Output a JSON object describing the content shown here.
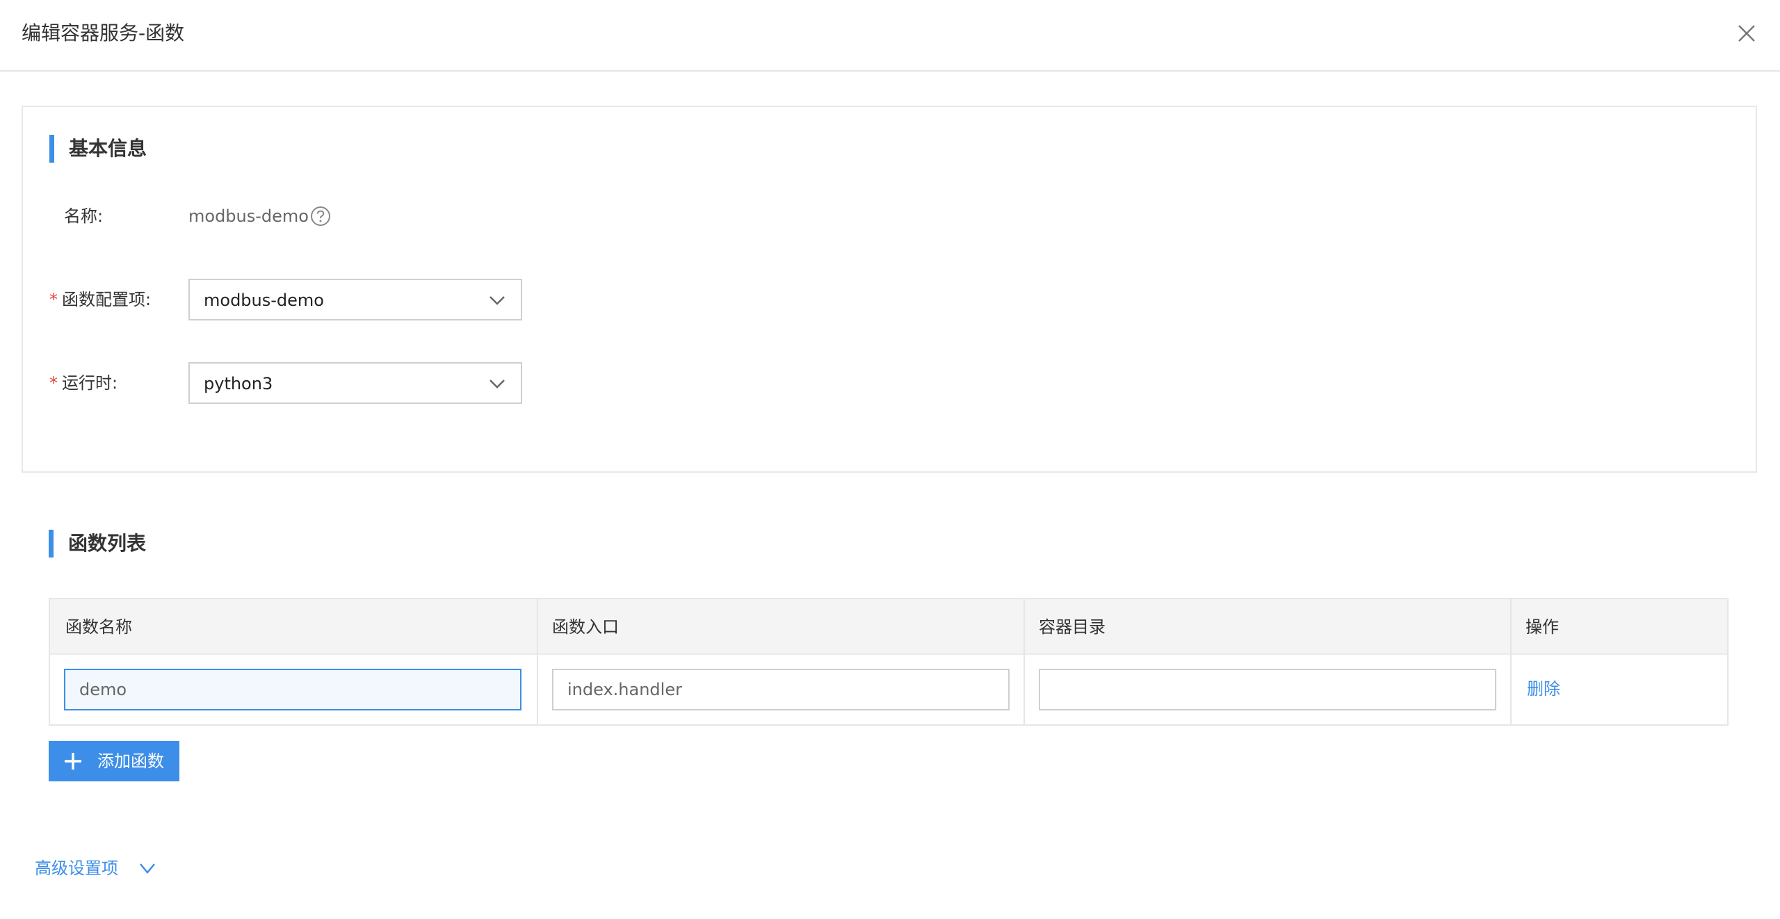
{
  "dialog": {
    "title": "编辑容器服务-函数"
  },
  "basic_info": {
    "section_title": "基本信息",
    "name_label": "名称:",
    "name_value": "modbus-demo",
    "function_config_label": "函数配置项:",
    "function_config_value": "modbus-demo",
    "runtime_label": "运行时:",
    "runtime_value": "python3",
    "required_marker": "*"
  },
  "function_list": {
    "section_title": "函数列表",
    "columns": [
      "函数名称",
      "函数入口",
      "容器目录",
      "操作"
    ],
    "rows": [
      {
        "name": "demo",
        "entry": "index.handler",
        "directory": "",
        "action": "删除"
      }
    ],
    "add_button_label": "添加函数"
  },
  "advanced": {
    "label": "高级设置项"
  },
  "colors": {
    "accent": "#3d8ee8",
    "required": "#e5473a",
    "header_bg": "#f4f4f4"
  },
  "icons": {
    "close": "close-icon",
    "help": "help-circle-icon",
    "dropdown": "chevron-down-icon",
    "add": "plus-icon"
  }
}
